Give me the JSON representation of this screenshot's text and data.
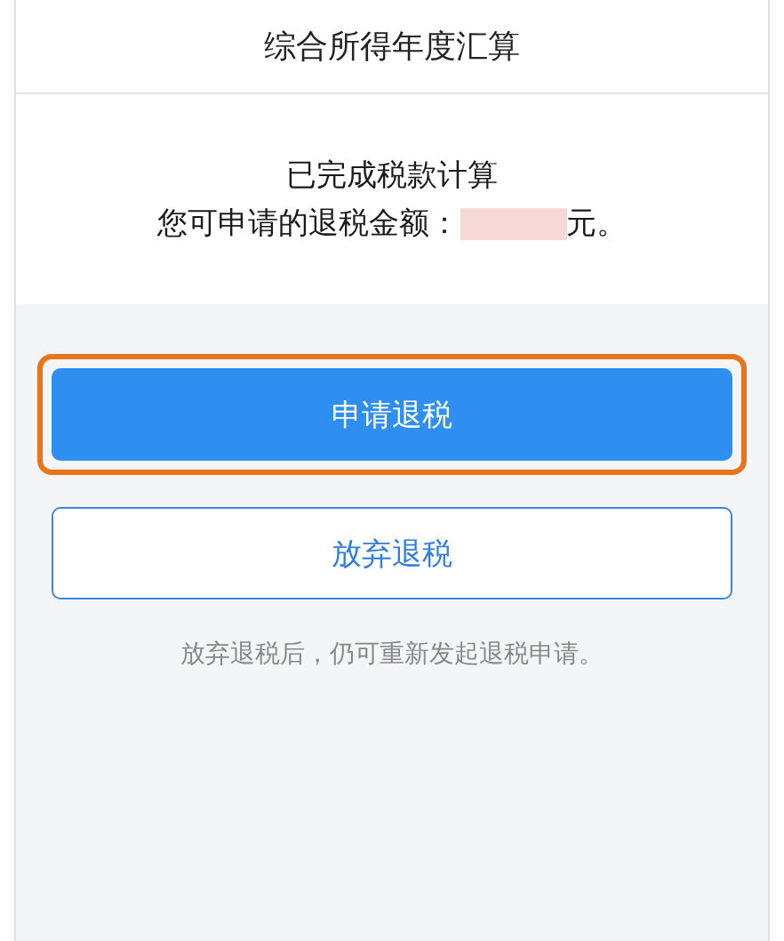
{
  "header": {
    "title": "综合所得年度汇算"
  },
  "result": {
    "status": "已完成税款计算",
    "amount_label": "您可申请的退税金额：",
    "amount_redacted": true,
    "amount_unit": "元。"
  },
  "buttons": [
    {
      "kind": "primary",
      "label": "申请退税",
      "highlighted": true
    },
    {
      "kind": "outline",
      "label": "放弃退税",
      "highlighted": false
    }
  ],
  "note": "放弃退税后，仍可重新发起退税申请。"
}
